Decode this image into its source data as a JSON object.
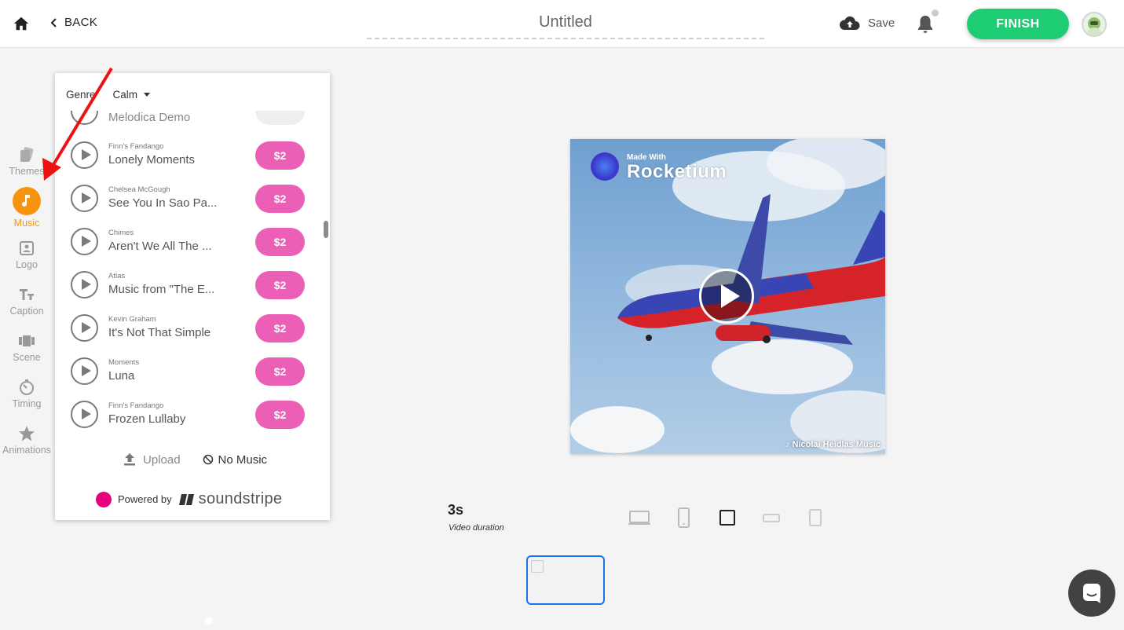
{
  "header": {
    "back_label": "BACK",
    "title_value": "Untitled",
    "save_label": "Save",
    "finish_label": "FINISH"
  },
  "sidebar": {
    "items": [
      {
        "label": "Themes",
        "icon": "themes-icon"
      },
      {
        "label": "Music",
        "icon": "music-note-icon",
        "active": true
      },
      {
        "label": "Logo",
        "icon": "logo-icon"
      },
      {
        "label": "Caption",
        "icon": "caption-icon"
      },
      {
        "label": "Scene",
        "icon": "scene-icon"
      },
      {
        "label": "Timing",
        "icon": "timing-icon"
      },
      {
        "label": "Animations",
        "icon": "star-icon"
      }
    ]
  },
  "music_panel": {
    "genre_label": "Genre",
    "genre_value": "Calm",
    "partial_track_title": "Melodica Demo",
    "tracks": [
      {
        "artist": "Finn's Fandango",
        "title": "Lonely Moments",
        "price": "$2"
      },
      {
        "artist": "Chelsea McGough",
        "title": "See You In Sao Pa...",
        "price": "$2"
      },
      {
        "artist": "Chimes",
        "title": "Aren't We All The ...",
        "price": "$2"
      },
      {
        "artist": "Atlas",
        "title": "Music from \"The E...",
        "price": "$2"
      },
      {
        "artist": "Kevin Graham",
        "title": "It's Not That Simple",
        "price": "$2"
      },
      {
        "artist": "Moments",
        "title": "Luna",
        "price": "$2"
      },
      {
        "artist": "Finn's Fandango",
        "title": "Frozen Lullaby",
        "price": "$2"
      }
    ],
    "upload_label": "Upload",
    "no_music_label": "No Music",
    "powered_by_label": "Powered by",
    "brand_name": "soundstripe"
  },
  "preview": {
    "watermark_small": "Made With",
    "watermark_brand": "Rocketium",
    "music_credit": "Nicolai Heidlas Music"
  },
  "video": {
    "duration_value": "3s",
    "duration_label": "Video duration"
  },
  "colors": {
    "accent_green": "#1ecd73",
    "music_orange": "#f7930e",
    "price_pink": "#ec5fb6",
    "soundstripe_pink": "#e6007e",
    "selection_blue": "#1a73e8",
    "annotation_red": "#ee1111"
  }
}
